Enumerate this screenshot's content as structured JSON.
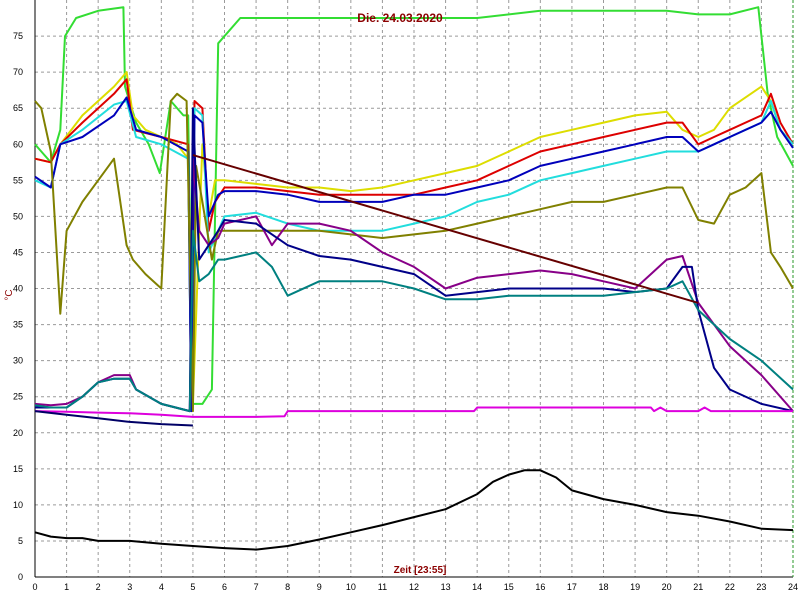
{
  "chart_data": {
    "type": "line",
    "title": "Die. 24.03.2020",
    "xlabel": "Zeit [23:55]",
    "ylabel": "°C",
    "xlim": [
      0,
      24
    ],
    "ylim": [
      0,
      80
    ],
    "x_ticks": [
      "0",
      "1",
      "2",
      "3",
      "4",
      "5",
      "6",
      "7",
      "8",
      "9",
      "10",
      "11",
      "12",
      "13",
      "14",
      "15",
      "16",
      "17",
      "18",
      "19",
      "20",
      "21",
      "22",
      "23",
      "24"
    ],
    "y_ticks": [
      "0",
      "5",
      "10",
      "15",
      "20",
      "25",
      "30",
      "35",
      "40",
      "45",
      "50",
      "55",
      "60",
      "65",
      "70",
      "75"
    ],
    "grid": true,
    "series": [
      {
        "color": "#33dd33",
        "x": [
          0,
          0.2,
          0.5,
          0.8,
          0.95,
          1.3,
          2,
          2.8,
          2.85,
          3.2,
          3.6,
          3.95,
          4.3,
          4.7,
          4.85,
          5.0,
          5.3,
          5.6,
          5.8,
          6.5,
          8,
          10,
          12,
          14,
          16,
          18,
          20,
          21,
          22,
          22.9,
          23.2,
          23.5,
          24
        ],
        "y": [
          60,
          59,
          57.5,
          62,
          75,
          77.5,
          78.5,
          79,
          68,
          63,
          60,
          56,
          66,
          64,
          64,
          24,
          24,
          26,
          74,
          77.5,
          77.5,
          77.5,
          77.5,
          77.5,
          78.5,
          78.5,
          78.5,
          78,
          78,
          79,
          67,
          61,
          57
        ]
      },
      {
        "color": "#dddd00",
        "x": [
          0,
          0.5,
          0.8,
          1.5,
          2.5,
          2.9,
          3.1,
          3.5,
          4,
          4.5,
          4.85,
          5.0,
          5.3,
          5.5,
          5.7,
          6,
          7,
          8,
          9,
          10,
          11,
          12,
          13,
          14,
          15,
          16,
          17,
          18,
          19,
          20,
          20.5,
          21,
          21.5,
          22,
          23,
          23.3,
          23.6,
          24
        ],
        "y": [
          58,
          57.5,
          60,
          64,
          68,
          70,
          64,
          62,
          61,
          60,
          58,
          24,
          60,
          50,
          55,
          55,
          54.5,
          54,
          54,
          53.5,
          54,
          55,
          56,
          57,
          59,
          61,
          62,
          63,
          64,
          64.5,
          62,
          61,
          62,
          65,
          68,
          66,
          62,
          60
        ]
      },
      {
        "color": "#dd0000",
        "x": [
          0,
          0.5,
          0.8,
          1.5,
          2.5,
          2.9,
          3.1,
          4,
          4.85,
          4.95,
          5.05,
          5.3,
          5.5,
          5.7,
          6,
          7,
          8,
          9,
          10,
          11,
          12,
          13,
          14,
          15,
          16,
          17,
          18,
          19,
          20,
          20.5,
          21,
          21.5,
          22,
          23,
          23.3,
          23.6,
          24
        ],
        "y": [
          58,
          57.5,
          60,
          63,
          67,
          69,
          62,
          61,
          60,
          23,
          66,
          65,
          48,
          52,
          54,
          54,
          53.5,
          53,
          53,
          53,
          53,
          54,
          55,
          57,
          59,
          60,
          61,
          62,
          63,
          63,
          60,
          61,
          62,
          64,
          67,
          63,
          60
        ]
      },
      {
        "color": "#22dddd",
        "x": [
          0,
          0.5,
          0.8,
          1.5,
          2.5,
          2.9,
          3.2,
          4,
          4.85,
          4.95,
          5.05,
          5.3,
          5.5,
          5.8,
          6,
          7,
          8,
          9,
          10,
          11,
          12,
          13,
          14,
          15,
          16,
          17,
          18,
          19,
          20,
          20.5,
          21,
          21.5,
          22,
          23,
          23.3,
          23.6,
          24
        ],
        "y": [
          55,
          54,
          60,
          62,
          65.5,
          66,
          61,
          60,
          58,
          23,
          65,
          64,
          45,
          48,
          50,
          50.5,
          49,
          48,
          48,
          48,
          49,
          50,
          52,
          53,
          55,
          56,
          57,
          58,
          59,
          59,
          59,
          60,
          61,
          63,
          66,
          62,
          60
        ]
      },
      {
        "color": "#0000bb",
        "x": [
          0,
          0.5,
          0.8,
          1.5,
          2.5,
          2.9,
          3.2,
          4,
          4.85,
          4.95,
          5.05,
          5.3,
          5.5,
          5.8,
          6,
          7,
          8,
          9,
          10,
          11,
          12,
          13,
          14,
          15,
          16,
          17,
          18,
          19,
          20,
          20.5,
          21,
          21.5,
          22,
          23,
          23.3,
          23.6,
          24
        ],
        "y": [
          55.5,
          54,
          60,
          61,
          64,
          66.5,
          62,
          61,
          59,
          23,
          64,
          63,
          50,
          53,
          53.5,
          53.5,
          53,
          52,
          52,
          52,
          53,
          53,
          54,
          55,
          57,
          58,
          59,
          60,
          61,
          61,
          59,
          60,
          61,
          63,
          64.5,
          62,
          59.5
        ]
      },
      {
        "color": "#808000",
        "x": [
          0,
          0.2,
          0.5,
          0.8,
          1,
          1.5,
          2,
          2.5,
          2.9,
          3.1,
          3.5,
          4,
          4.3,
          4.5,
          4.8,
          5.0,
          5.1,
          5.3,
          5.6,
          5.8,
          6,
          7,
          8,
          9,
          10,
          11,
          12,
          13,
          14,
          15,
          16,
          17,
          18,
          19,
          20,
          20.5,
          21,
          21.5,
          22,
          22.5,
          23,
          23.3,
          23.6,
          24
        ],
        "y": [
          66,
          65,
          59,
          36.5,
          48,
          52,
          55,
          58,
          46,
          44,
          42,
          40,
          66,
          67,
          66,
          23,
          57,
          52,
          44,
          48,
          48,
          48,
          48,
          48,
          47.5,
          47,
          47.5,
          48,
          49,
          50,
          51,
          52,
          52,
          53,
          54,
          54,
          49.5,
          49,
          53,
          54,
          56,
          45,
          43,
          40
        ]
      },
      {
        "color": "#880088",
        "x": [
          0,
          0.5,
          1,
          1.5,
          2,
          2.5,
          3,
          3.2,
          4,
          4.9,
          5.0,
          5.2,
          5.5,
          5.8,
          6,
          7,
          7.5,
          8,
          9,
          10,
          11,
          12,
          13,
          14,
          15,
          16,
          17,
          18,
          19,
          19.5,
          20,
          20.5,
          21,
          22,
          23,
          24
        ],
        "y": [
          24,
          23.8,
          24,
          25,
          27,
          28,
          28,
          26,
          24,
          23,
          58,
          48,
          46,
          47,
          49,
          50,
          46,
          49,
          49,
          48,
          45,
          43,
          40,
          41.5,
          42,
          42.5,
          42,
          41,
          40,
          42,
          44,
          44.5,
          38,
          32,
          28,
          23
        ]
      },
      {
        "color": "#000088",
        "x": [
          0,
          0.5,
          1,
          1.5,
          2,
          2.5,
          3,
          3.2,
          4,
          4.9,
          5.0,
          5.2,
          5.5,
          5.8,
          6,
          7,
          8,
          9,
          10,
          11,
          12,
          13,
          14,
          15,
          16,
          17,
          18,
          19,
          20,
          20.5,
          20.8,
          21,
          21.5,
          22,
          23,
          24
        ],
        "y": [
          23.5,
          23.5,
          23.5,
          25,
          27,
          27.5,
          27.5,
          26,
          24,
          23,
          65,
          44,
          46,
          48,
          49.5,
          49,
          46,
          44.5,
          44,
          43,
          42,
          39,
          39.5,
          40,
          40,
          40,
          40,
          39.5,
          40,
          43,
          43,
          37,
          29,
          26,
          24,
          23
        ]
      },
      {
        "color": "#008080",
        "x": [
          0,
          0.5,
          1,
          1.5,
          2,
          2.5,
          3,
          3.2,
          4,
          4.9,
          5.0,
          5.2,
          5.5,
          5.8,
          6,
          7,
          7.5,
          8,
          9,
          10,
          11,
          12,
          13,
          14,
          15,
          16,
          17,
          18,
          19,
          20,
          20.5,
          21,
          22,
          23,
          24
        ],
        "y": [
          23.8,
          23.5,
          23.5,
          25,
          27,
          27.5,
          27.5,
          26,
          24,
          23,
          48,
          41,
          42,
          44,
          44,
          45,
          43,
          39,
          41,
          41,
          41,
          40,
          38.5,
          38.5,
          39,
          39,
          39,
          39,
          39.5,
          40,
          41,
          37,
          33,
          30,
          26
        ]
      },
      {
        "color": "#dd00dd",
        "x": [
          0,
          1,
          2,
          3,
          4,
          5,
          6,
          7,
          7.9,
          8,
          10,
          12,
          13.9,
          14,
          16,
          18,
          19.5,
          19.6,
          19.8,
          20,
          21,
          21.2,
          21.4,
          22,
          23,
          24
        ],
        "y": [
          23,
          22.9,
          22.8,
          22.7,
          22.5,
          22.2,
          22.2,
          22.2,
          22.3,
          23,
          23,
          23,
          23,
          23.5,
          23.5,
          23.5,
          23.5,
          23,
          23.5,
          23,
          23,
          23.5,
          23,
          23,
          23,
          23
        ]
      },
      {
        "color": "#000066",
        "x": [
          0,
          1,
          2,
          3,
          4,
          5
        ],
        "y": [
          23,
          22.5,
          22,
          21.5,
          21.2,
          21
        ]
      },
      {
        "color": "#660000",
        "x": [
          5.0,
          21.0
        ],
        "y": [
          58.5,
          38
        ]
      },
      {
        "color": "#000000",
        "x": [
          0,
          0.5,
          1,
          1.5,
          2,
          3,
          4,
          5,
          6,
          7,
          8,
          9,
          10,
          11,
          12,
          13,
          14,
          14.5,
          15,
          15.5,
          16,
          16.5,
          17,
          18,
          19,
          20,
          21,
          22,
          23,
          24
        ],
        "y": [
          6.2,
          5.6,
          5.4,
          5.4,
          5,
          5,
          4.6,
          4.3,
          4,
          3.8,
          4.3,
          5.2,
          6.2,
          7.2,
          8.3,
          9.4,
          11.5,
          13.2,
          14.2,
          14.8,
          14.8,
          13.8,
          12,
          10.8,
          10,
          9,
          8.5,
          7.7,
          6.7,
          6.5
        ]
      }
    ]
  }
}
